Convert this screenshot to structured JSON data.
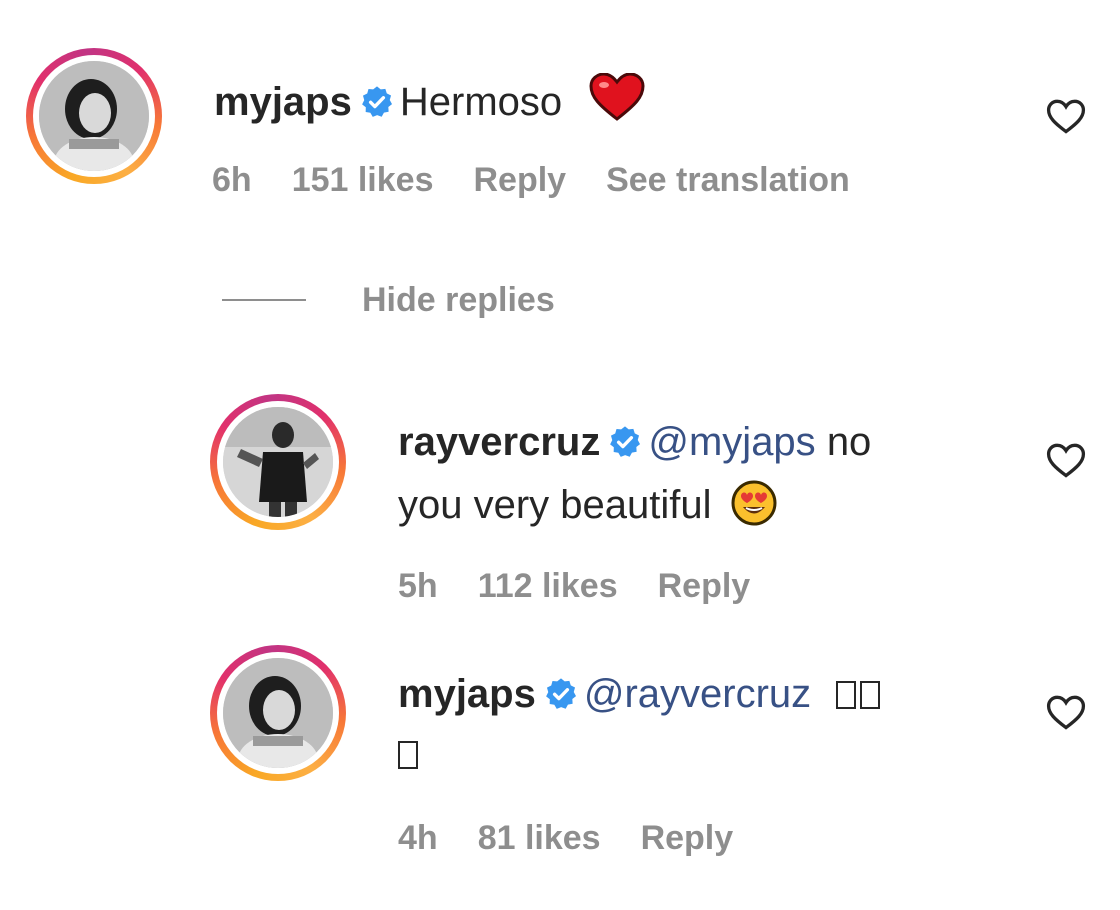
{
  "comments": [
    {
      "username": "myjaps",
      "text": "Hermoso",
      "emoji": "red-heart",
      "time": "6h",
      "likes": "151 likes",
      "reply": "Reply",
      "translate": "See translation"
    },
    {
      "username": "rayvercruz",
      "mention": "@myjaps",
      "text_line1": "no",
      "text_line2": "you very beautiful",
      "emoji": "heart-eyes",
      "time": "5h",
      "likes": "112 likes",
      "reply": "Reply"
    },
    {
      "username": "myjaps",
      "mention": "@rayvercruz",
      "text_line2": "",
      "time": "4h",
      "likes": "81 likes",
      "reply": "Reply"
    }
  ],
  "hide_replies": "Hide replies",
  "colors": {
    "mention": "#385185",
    "verified": "#3897f0",
    "muted": "#8e8e8e",
    "heart": "#ed4956"
  }
}
